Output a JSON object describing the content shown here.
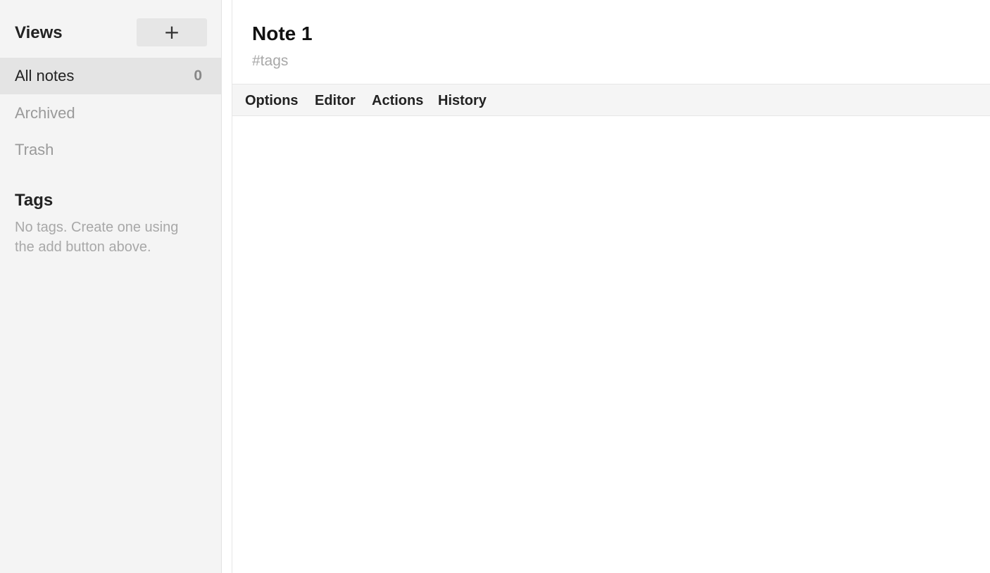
{
  "sidebar": {
    "views_title": "Views",
    "add_label": "+",
    "views": [
      {
        "label": "All notes",
        "count": "0",
        "active": true
      },
      {
        "label": "Archived"
      },
      {
        "label": "Trash"
      }
    ],
    "tags_title": "Tags",
    "tags_empty": "No tags. Create one using the add button above."
  },
  "note": {
    "title": "Note 1",
    "tags_placeholder": "#tags"
  },
  "toolbar": {
    "options": "Options",
    "editor": "Editor",
    "actions": "Actions",
    "history": "History"
  }
}
